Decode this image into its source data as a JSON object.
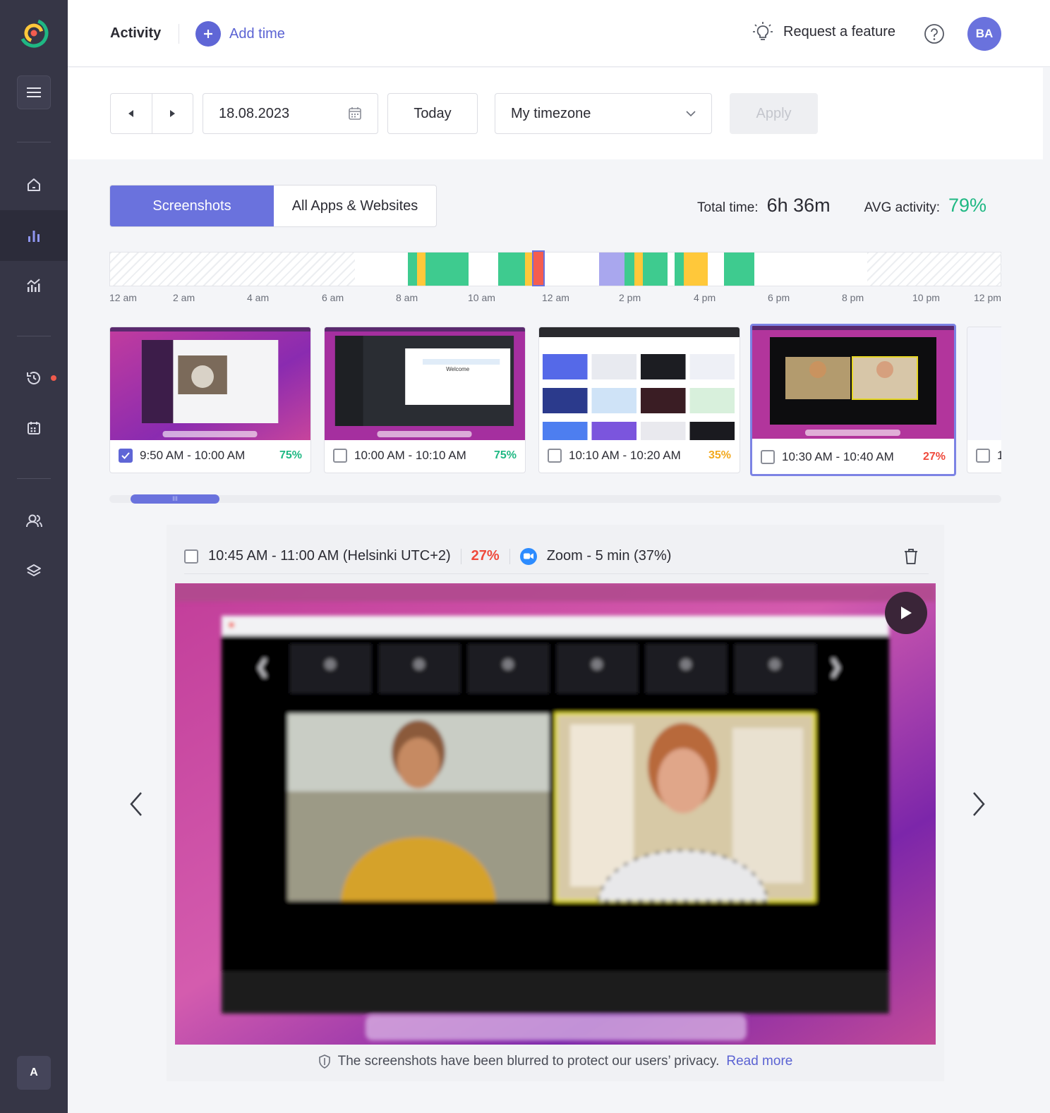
{
  "app": {
    "logo_icon": "timetracker-logo-icon"
  },
  "sidebar": {
    "items": [
      {
        "icon": "home-icon"
      },
      {
        "icon": "bar-chart-icon",
        "active": true
      },
      {
        "icon": "reports-icon"
      },
      {
        "icon": "history-icon",
        "notification": true
      },
      {
        "icon": "calendar-icon"
      },
      {
        "icon": "team-icon"
      },
      {
        "icon": "layers-icon"
      }
    ],
    "user_initial": "A"
  },
  "topbar": {
    "title": "Activity",
    "add_time_label": "Add time",
    "request_feature_label": "Request a feature",
    "avatar_initials": "BA"
  },
  "filters": {
    "date": "18.08.2023",
    "today_label": "Today",
    "timezone": "My timezone",
    "apply_label": "Apply"
  },
  "tabs": [
    {
      "label": "Screenshots",
      "active": true
    },
    {
      "label": "All Apps & Websites",
      "active": false
    }
  ],
  "summary": {
    "total_time_label": "Total time:",
    "total_time": "6h 36m",
    "avg_activity_label": "AVG activity:",
    "avg_activity": "79%"
  },
  "timeline": {
    "ticks": [
      "12 am",
      "2 am",
      "4 am",
      "6 am",
      "8 am",
      "10 am",
      "12 am",
      "2 pm",
      "4 pm",
      "6 pm",
      "8 pm",
      "10 pm",
      "12 pm"
    ],
    "colors": {
      "high": "#3ecb8f",
      "medium": "#ffc83a",
      "low": "#f45d4f",
      "manual": "#a9a7ee"
    }
  },
  "thumbnails": [
    {
      "time": "9:50 AM - 10:00 AM",
      "activity": "75%",
      "checked": true,
      "color": "#1fb883"
    },
    {
      "time": "10:00 AM - 10:10 AM",
      "activity": "75%",
      "checked": false,
      "color": "#1fb883"
    },
    {
      "time": "10:10 AM - 10:20 AM",
      "activity": "35%",
      "checked": false,
      "color": "#f2a91e"
    },
    {
      "time": "10:30 AM - 10:40 AM",
      "activity": "27%",
      "checked": false,
      "color": "#ef4a3c"
    },
    {
      "time": "1",
      "activity": "",
      "checked": false,
      "color": "#1fb883"
    }
  ],
  "scroll_handle": "III",
  "detail": {
    "time_range": "10:45 AM - 11:00 AM (Helsinki UTC+2)",
    "activity": "27%",
    "app_usage": "Zoom - 5 min (37%)",
    "privacy_text": "The screenshots have been blurred to protect our users’ privacy.",
    "read_more": "Read more"
  }
}
